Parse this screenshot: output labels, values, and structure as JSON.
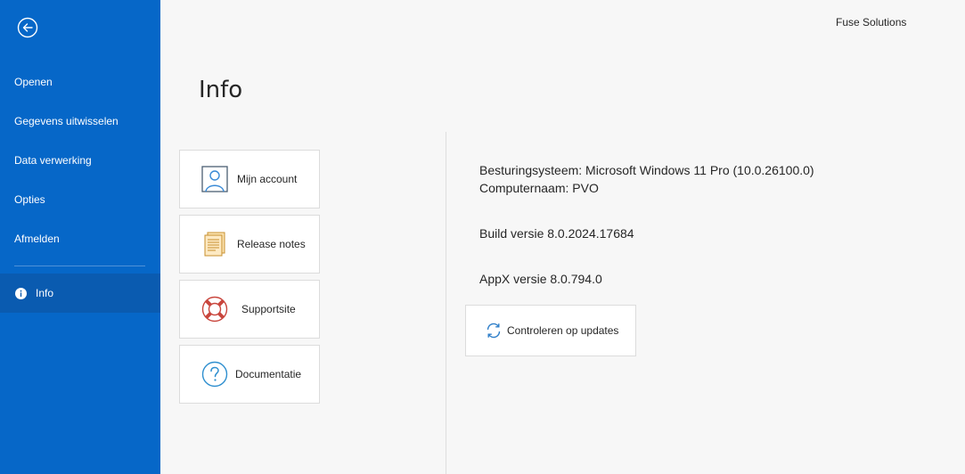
{
  "header": {
    "company": "Fuse Solutions"
  },
  "page": {
    "title": "Info"
  },
  "sidebar": {
    "items": [
      {
        "label": "Openen"
      },
      {
        "label": "Gegevens uitwisselen"
      },
      {
        "label": "Data verwerking"
      },
      {
        "label": "Opties"
      },
      {
        "label": "Afmelden"
      }
    ],
    "active": {
      "label": "Info",
      "icon": "info-icon"
    }
  },
  "tiles": [
    {
      "label": "Mijn account",
      "icon": "account-icon"
    },
    {
      "label": "Release notes",
      "icon": "release-notes-icon"
    },
    {
      "label": "Supportsite",
      "icon": "lifebuoy-icon"
    },
    {
      "label": "Documentatie",
      "icon": "help-icon"
    }
  ],
  "info": {
    "os": "Besturingsysteem: Microsoft Windows 11 Pro (10.0.26100.0)",
    "computer": "Computernaam: PVO",
    "build": "Build versie 8.0.2024.17684",
    "appx": "AppX versie 8.0.794.0",
    "update_label": "Controleren op updates"
  },
  "colors": {
    "sidebar": "#0667c8",
    "sidebar_active": "#0a5bb0",
    "accent": "#1f6fbf"
  }
}
